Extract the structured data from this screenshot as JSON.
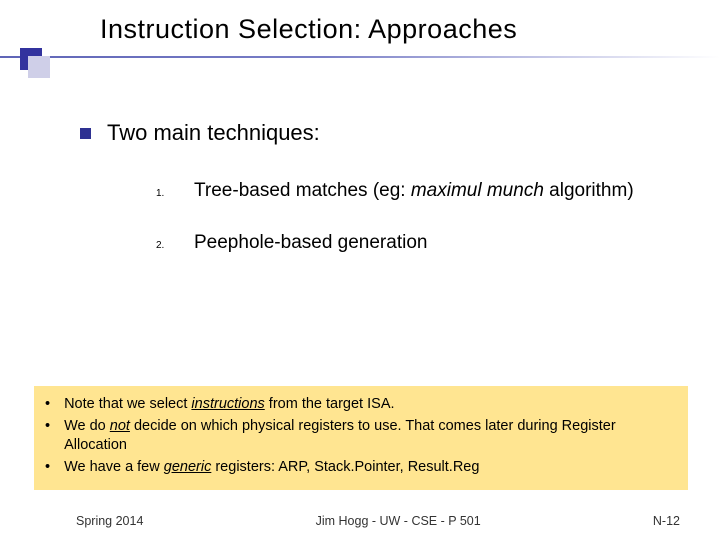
{
  "title": "Instruction Selection: Approaches",
  "main_bullet": "Two main techniques:",
  "items": [
    {
      "num": "1.",
      "pre": "Tree-based matches (eg: ",
      "ital": "maximul munch",
      "post": " algorithm)"
    },
    {
      "num": "2.",
      "pre": "Peephole-based generation",
      "ital": "",
      "post": ""
    }
  ],
  "notes": {
    "n1a": "Note that we select ",
    "n1b": "instructions",
    "n1c": " from the target ISA.",
    "n2a": "We do ",
    "n2b": "not",
    "n2c": " decide on which physical registers to use.  That comes later during Register Allocation",
    "n3a": "We have a few ",
    "n3b": "generic",
    "n3c": " registers: ARP, Stack.Pointer, Result.Reg"
  },
  "footer": {
    "left": "Spring 2014",
    "center": "Jim Hogg - UW - CSE - P 501",
    "right": "N-12"
  }
}
